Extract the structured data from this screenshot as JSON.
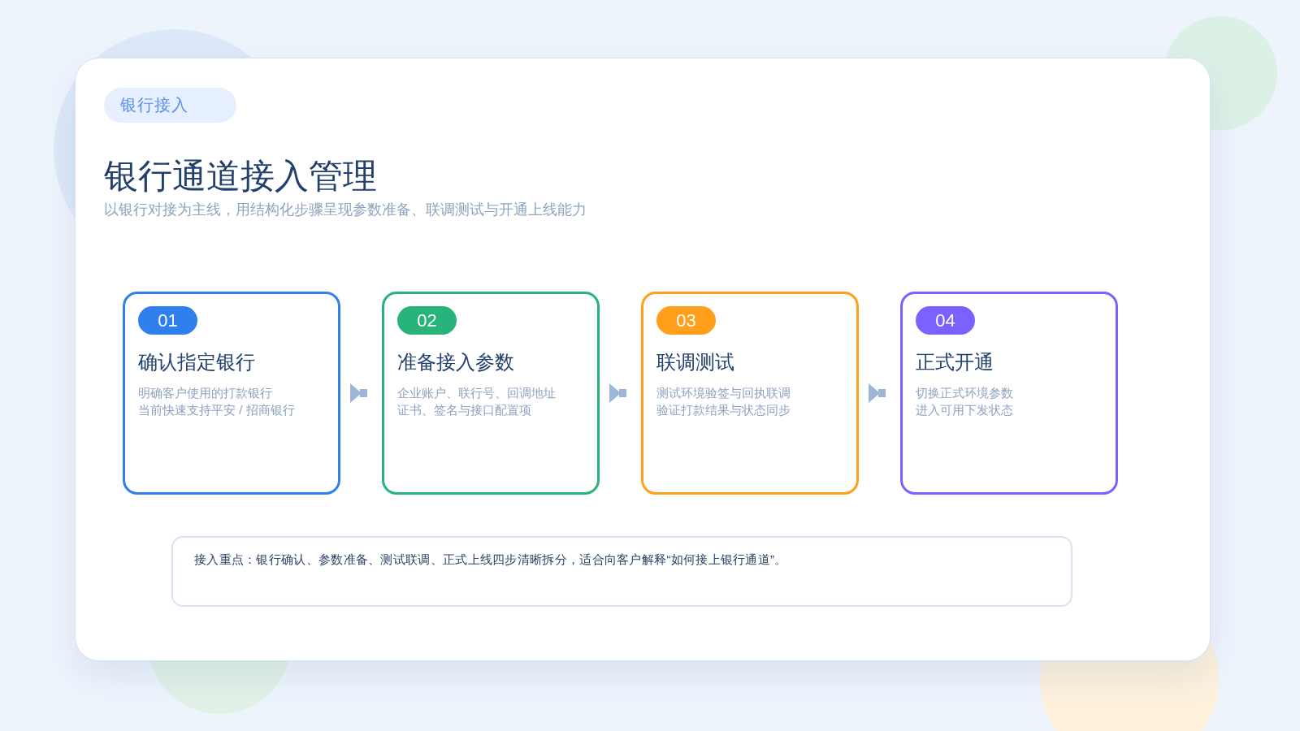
{
  "tag": {
    "label": "银行接入"
  },
  "title": "银行通道接入管理",
  "subtitle": "以银行对接为主线，用结构化步骤呈现参数准备、联调测试与开通上线能力",
  "steps": [
    {
      "number": "01",
      "title": "确认指定银行",
      "lines": [
        "明确客户使用的打款银行",
        "当前快速支持平安 / 招商银行"
      ],
      "color": "#2f80ed"
    },
    {
      "number": "02",
      "title": "准备接入参数",
      "lines": [
        "企业账户、联行号、回调地址",
        "证书、签名与接口配置项"
      ],
      "color": "#27b37a"
    },
    {
      "number": "03",
      "title": "联调测试",
      "lines": [
        "测试环境验签与回执联调",
        "验证打款结果与状态同步"
      ],
      "color": "#ff9f1c"
    },
    {
      "number": "04",
      "title": "正式开通",
      "lines": [
        "切换正式环境参数",
        "进入可用下发状态"
      ],
      "color": "#7b61ff"
    }
  ],
  "note": "接入重点：银行确认、参数准备、测试联调、正式上线四步清晰拆分，适合向客户解释“如何接上银行通道”。"
}
